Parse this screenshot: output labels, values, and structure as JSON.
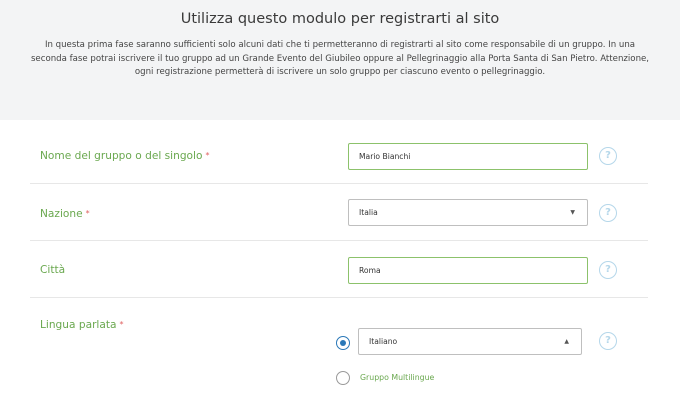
{
  "intro": {
    "title": "Utilizza questo modulo per registrarti al sito",
    "text": "In questa prima fase saranno sufficienti solo alcuni dati che ti permetteranno di registrarti al sito come responsabile di un gruppo. In una seconda fase potrai iscrivere il tuo gruppo ad un Grande Evento del Giubileo oppure al Pellegrinaggio alla Porta Santa di San Pietro. Attenzione, ogni registrazione permetterà di iscrivere un solo gruppo per ciascuno evento o pellegrinaggio."
  },
  "form": {
    "required_mark": "*",
    "help_symbol": "?",
    "group_name": {
      "label": "Nome del gruppo o del singolo",
      "value": "Mario Bianchi"
    },
    "nation": {
      "label": "Nazione",
      "value": "Italia",
      "caret": "▼"
    },
    "city": {
      "label": "Città",
      "value": "Roma"
    },
    "language": {
      "label": "Lingua parlata",
      "value": "Italiano",
      "caret": "▲",
      "multilingual_label": "Gruppo Multilingue"
    }
  },
  "colors": {
    "label_green": "#6aa84f",
    "field_border": "#8cc26b",
    "required_red": "#e06060",
    "help_blue": "#b5d7ea",
    "radio_blue": "#2a78b8"
  }
}
